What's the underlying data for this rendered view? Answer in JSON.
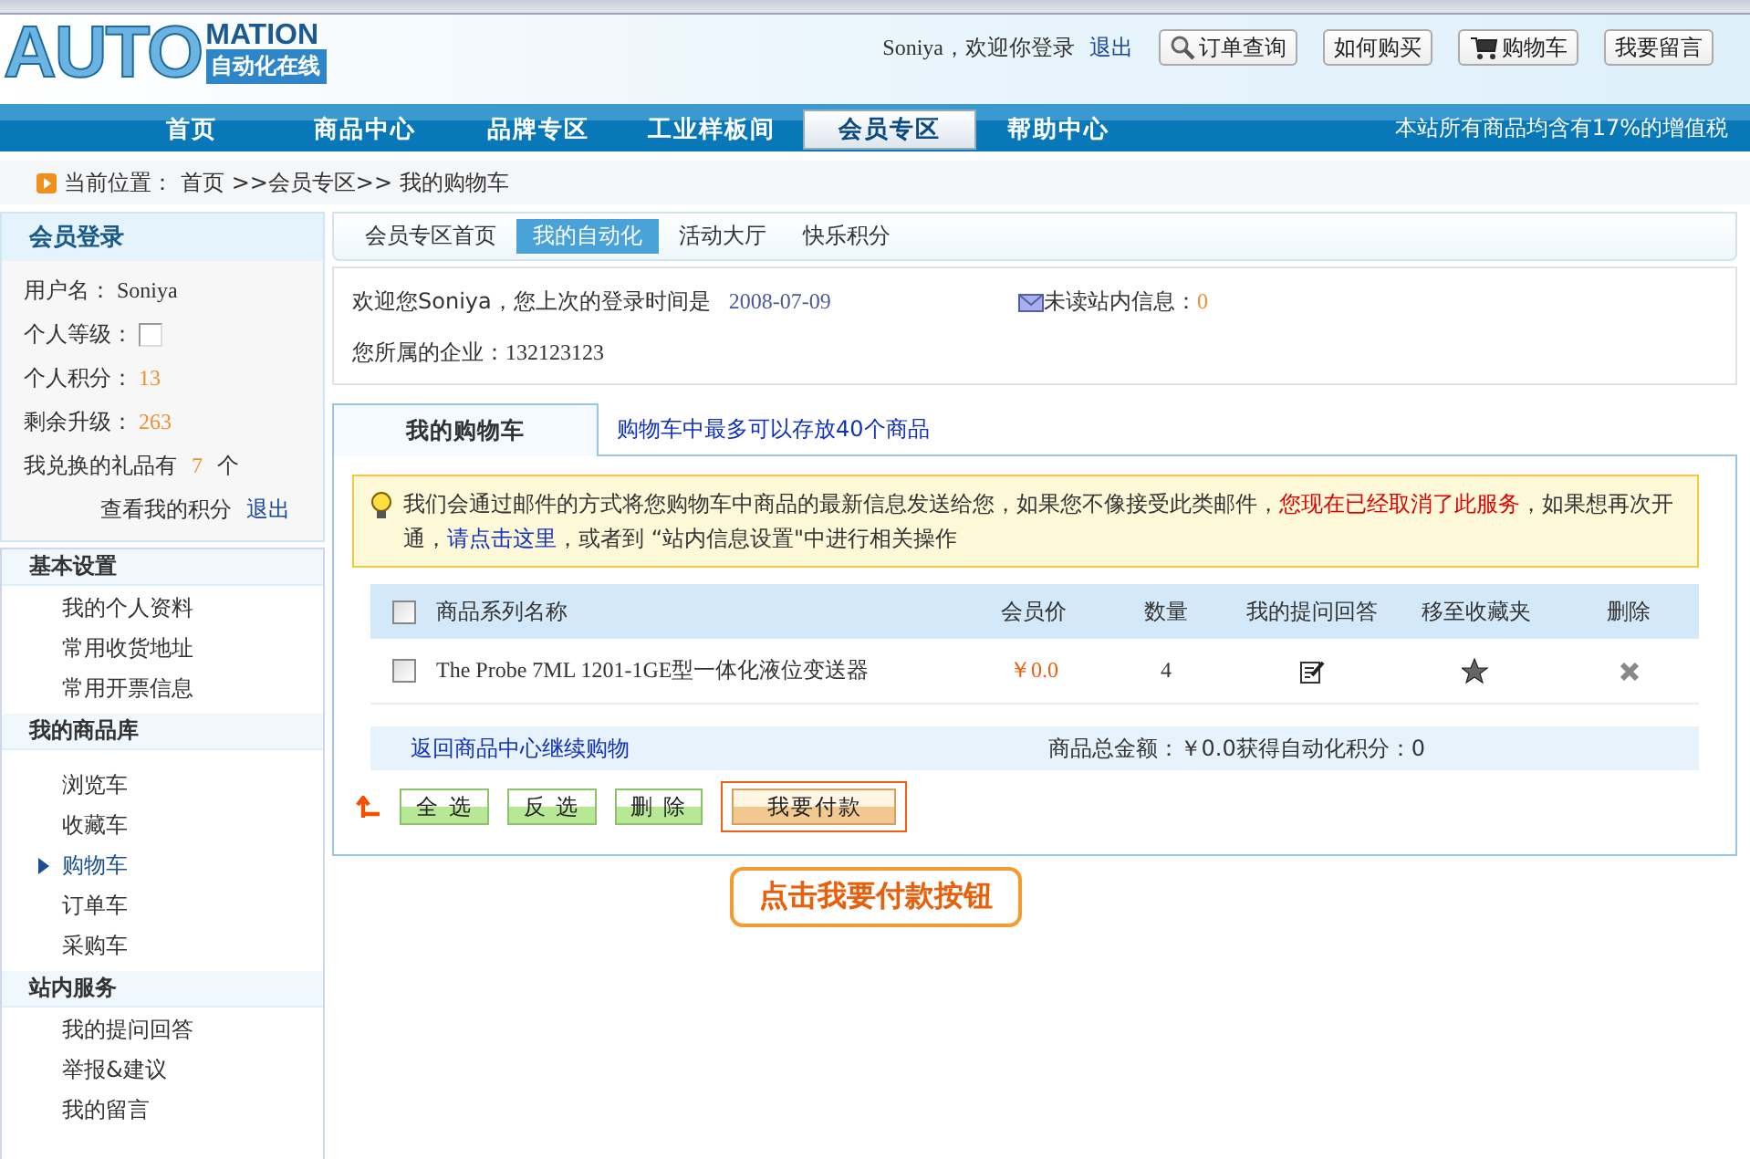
{
  "logo": {
    "main": "AUTO",
    "sup": "MATION",
    "sub": "自动化在线"
  },
  "top_bar": {
    "greeting": "Soniya，欢迎你登录",
    "logout": "退出",
    "buttons": [
      {
        "label": "订单查询",
        "kind": "search"
      },
      {
        "label": "如何购买",
        "kind": "plain"
      },
      {
        "label": "购物车",
        "kind": "cart"
      },
      {
        "label": "我要留言",
        "kind": "plain"
      }
    ]
  },
  "nav": {
    "items": [
      {
        "label": "首页",
        "selected": false
      },
      {
        "label": "商品中心",
        "selected": false
      },
      {
        "label": "品牌专区",
        "selected": false
      },
      {
        "label": "工业样板间",
        "selected": false
      },
      {
        "label": "会员专区",
        "selected": true
      },
      {
        "label": "帮助中心",
        "selected": false
      }
    ],
    "notice": "本站所有商品均含有17%的增值税"
  },
  "breadcrumb": {
    "label": "当前位置：",
    "path": "首页 >>会员专区>> 我的购物车"
  },
  "member_login": {
    "title": "会员登录",
    "fields": [
      {
        "kind": "text",
        "label": "用户名：",
        "value": "Soniya"
      },
      {
        "kind": "box",
        "label": "个人等级："
      },
      {
        "kind": "number",
        "label": "个人积分：",
        "value": "13"
      },
      {
        "kind": "number",
        "label": "剩余升级：",
        "value": "263"
      }
    ],
    "gifts": {
      "before": "我兑换的礼品有",
      "count": "7",
      "after": "个"
    },
    "links": [
      "查看我的积分",
      "退出"
    ]
  },
  "sidebar": {
    "sections": [
      {
        "title": "基本设置",
        "items": [
          {
            "label": "我的个人资料",
            "selected": false
          },
          {
            "label": "常用收货地址",
            "selected": false
          },
          {
            "label": "常用开票信息",
            "selected": false
          }
        ]
      },
      {
        "title": "我的商品库",
        "items": [
          {
            "label": "浏览车",
            "selected": false
          },
          {
            "label": "收藏车",
            "selected": false
          },
          {
            "label": "购物车",
            "selected": true
          },
          {
            "label": "订单车",
            "selected": false
          },
          {
            "label": "采购车",
            "selected": false
          }
        ]
      },
      {
        "title": "站内服务",
        "items": [
          {
            "label": "我的提问回答",
            "selected": false
          },
          {
            "label": "举报&建议",
            "selected": false
          },
          {
            "label": "我的留言",
            "selected": false
          }
        ]
      }
    ]
  },
  "sub_tabs": [
    {
      "label": "会员专区首页",
      "selected": false
    },
    {
      "label": "我的自动化",
      "selected": true
    },
    {
      "label": "活动大厅",
      "selected": false
    },
    {
      "label": "快乐积分",
      "selected": false
    }
  ],
  "welcome": {
    "greeting": "欢迎您Soniya，您上次的登录时间是",
    "date": "2008-07-09",
    "unread_label": "未读站内信息：",
    "unread": "0",
    "company_label": "您所属的企业：",
    "company": "132123123"
  },
  "cart": {
    "tabs": [
      {
        "label": "我的购物车",
        "selected": true
      }
    ],
    "limit_note": "购物车中最多可以存放40个商品",
    "notice": [
      {
        "kind": "plain",
        "text": "我们会通过邮件的方式将您购物车中商品的最新信息发送给您，如果您不像接受此类邮件，"
      },
      {
        "kind": "alert",
        "text": "您现在已经取消了此服务"
      },
      {
        "kind": "plain",
        "text": "，如果想再次开通，"
      },
      {
        "kind": "link",
        "text": "请点击这里"
      },
      {
        "kind": "plain",
        "text": "，或者到 “站内信息设置\"中进行相关操作"
      }
    ],
    "table": {
      "all_checked": false,
      "columns": [
        "商品系列名称",
        "会员价",
        "数量",
        "我的提问回答",
        "移至收藏夹",
        "删除"
      ],
      "rows": [
        {
          "checked": false,
          "name": "The Probe 7ML 1201-1GE型一体化液位变送器",
          "price": "￥0.0",
          "quantity": "4"
        }
      ]
    },
    "back_link": "返回商品中心继续购物",
    "total": "商品总金额：￥0.0获得自动化积分：0",
    "buttons": [
      {
        "label": "全 选",
        "kind": "green",
        "highlighted": false
      },
      {
        "label": "反 选",
        "kind": "green",
        "highlighted": false
      },
      {
        "label": "删 除",
        "kind": "green",
        "highlighted": false
      },
      {
        "label": "我要付款",
        "kind": "pay",
        "highlighted": true
      }
    ]
  },
  "callout": "点击我要付款按钮"
}
